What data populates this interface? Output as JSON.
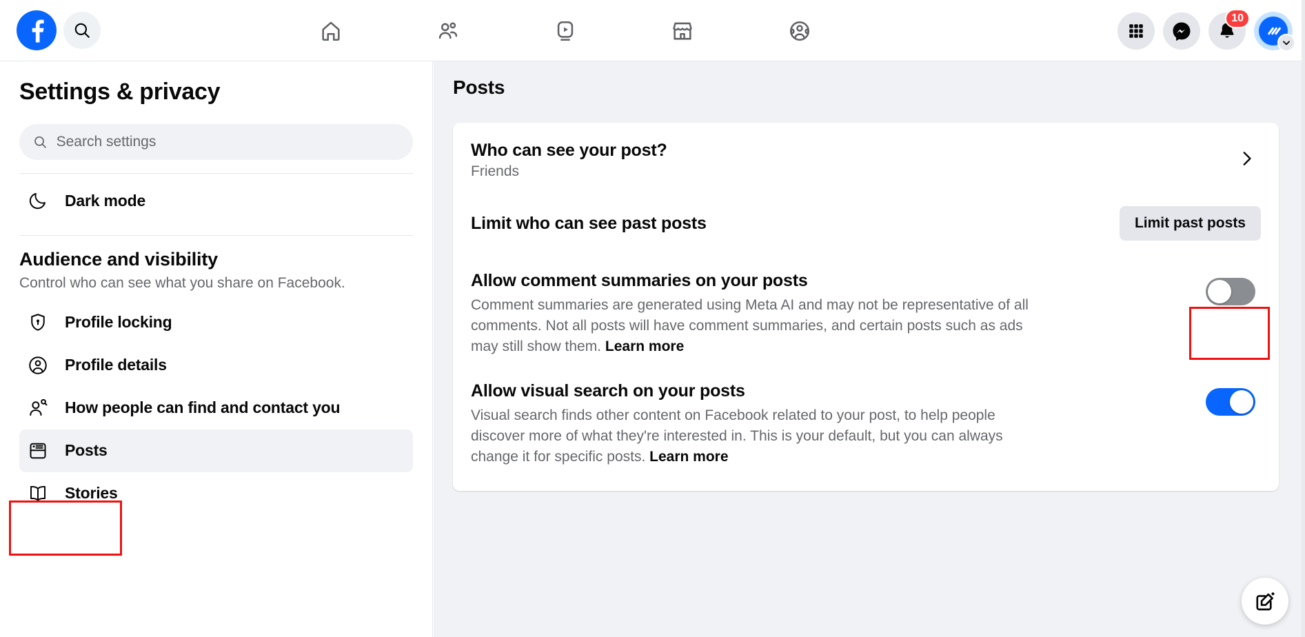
{
  "topbar": {
    "logo_icon": "facebook-logo",
    "search_icon": "search-icon",
    "nav": [
      {
        "name": "home",
        "icon": "home-icon"
      },
      {
        "name": "friends",
        "icon": "friends-icon"
      },
      {
        "name": "video",
        "icon": "video-icon"
      },
      {
        "name": "marketplace",
        "icon": "marketplace-icon"
      },
      {
        "name": "groups",
        "icon": "groups-icon"
      }
    ],
    "menu_icon": "grid-menu-icon",
    "messenger_icon": "messenger-icon",
    "notifications_icon": "bell-icon",
    "notifications_count": "10",
    "avatar_icon": "profile-avatar",
    "avatar_chevron_icon": "chevron-down-icon"
  },
  "sidebar": {
    "title": "Settings & privacy",
    "search": {
      "placeholder": "Search settings",
      "value": "",
      "icon": "search-icon"
    },
    "dark_mode": {
      "label": "Dark mode",
      "icon": "moon-icon"
    },
    "section": {
      "heading": "Audience and visibility",
      "description": "Control who can see what you share on Facebook."
    },
    "items": [
      {
        "label": "Profile locking",
        "icon": "shield-lock-icon",
        "selected": false
      },
      {
        "label": "Profile details",
        "icon": "profile-circle-icon",
        "selected": false
      },
      {
        "label": "How people can find and contact you",
        "icon": "person-search-icon",
        "selected": false
      },
      {
        "label": "Posts",
        "icon": "posts-icon",
        "selected": true
      },
      {
        "label": "Stories",
        "icon": "book-icon",
        "selected": false
      }
    ]
  },
  "main": {
    "title": "Posts",
    "who_can_see": {
      "title": "Who can see your post?",
      "value": "Friends",
      "chevron_icon": "chevron-right-icon"
    },
    "limit_past": {
      "title": "Limit who can see past posts",
      "button_label": "Limit past posts"
    },
    "comment_summaries": {
      "title": "Allow comment summaries on your posts",
      "description": "Comment summaries are generated using Meta AI and may not be representative of all comments. Not all posts will have comment summaries, and certain posts such as ads may still show them.",
      "learn_more": "Learn more",
      "toggle_state": "off"
    },
    "visual_search": {
      "title": "Allow visual search on your posts",
      "description": "Visual search finds other content on Facebook related to your post, to help people discover more of what they're interested in. This is your default, but you can always change it for specific posts.",
      "learn_more": "Learn more",
      "toggle_state": "on"
    },
    "fab_icon": "compose-edit-icon"
  },
  "colors": {
    "brand_blue": "#0866ff",
    "badge_red": "#fa3e3e",
    "toggle_off": "#8a8d91",
    "annotation_red": "#ee1111",
    "page_bg": "#f0f2f5"
  }
}
